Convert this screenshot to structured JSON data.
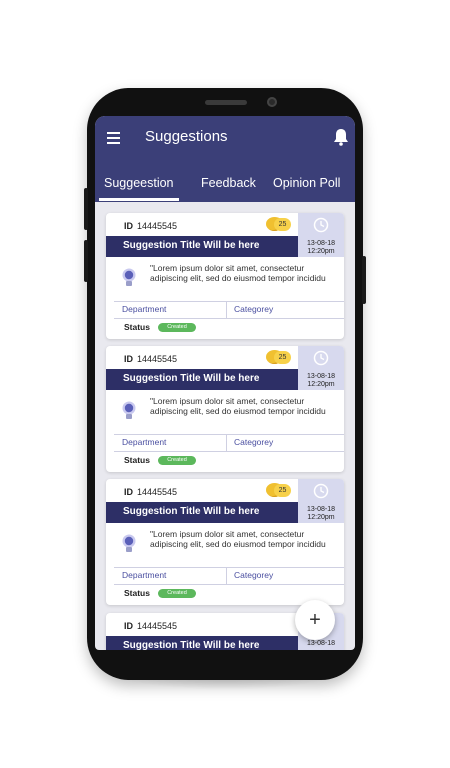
{
  "header": {
    "title": "Suggestions",
    "menu_icon": "hamburger-menu-icon",
    "bell_icon": "bell-icon",
    "color": "#3b3f78"
  },
  "tabs": [
    {
      "label": "Suggeestion",
      "active": true
    },
    {
      "label": "Feedback",
      "active": false
    },
    {
      "label": "Opinion Poll",
      "active": false
    }
  ],
  "cards": [
    {
      "id_label": "ID",
      "id_value": "14445545",
      "coins": "25",
      "title": "Suggestion Title Will be here",
      "date": "13-08-18",
      "time": "12:20pm",
      "description": "\"Lorem ipsum dolor sit amet, consectetur adipiscing elit, sed do eiusmod tempor incididu",
      "department": "Department",
      "category": "Categorey",
      "status_label": "Status",
      "status_value": "Created"
    },
    {
      "id_label": "ID",
      "id_value": "14445545",
      "coins": "25",
      "title": "Suggestion Title Will be here",
      "date": "13-08-18",
      "time": "12:20pm",
      "description": "\"Lorem ipsum dolor sit amet, consectetur adipiscing elit, sed do eiusmod tempor incididu",
      "department": "Department",
      "category": "Categorey",
      "status_label": "Status",
      "status_value": "Created"
    },
    {
      "id_label": "ID",
      "id_value": "14445545",
      "coins": "25",
      "title": "Suggestion Title Will be here",
      "date": "13-08-18",
      "time": "12:20pm",
      "description": "\"Lorem ipsum dolor sit amet, consectetur adipiscing elit, sed do eiusmod tempor incididu",
      "department": "Department",
      "category": "Categorey",
      "status_label": "Status",
      "status_value": "Created"
    },
    {
      "id_label": "ID",
      "id_value": "14445545",
      "title": "Suggestion Title Will be here",
      "date": "13-08-18"
    }
  ],
  "fab": {
    "label": "+"
  },
  "colors": {
    "accent": "#3b3f78",
    "title_bar": "#2d2f66",
    "status_created": "#5cb85c",
    "coin": "#f0c030"
  }
}
